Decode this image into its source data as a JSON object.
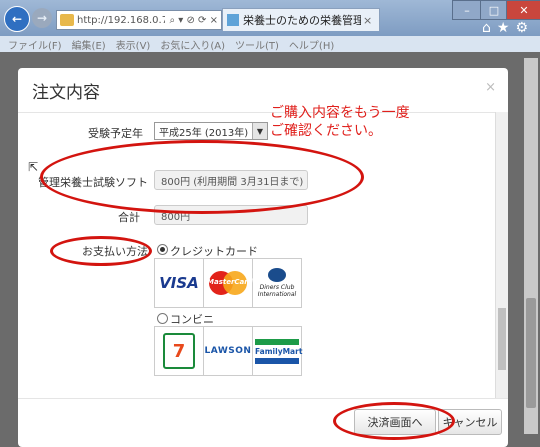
{
  "browser": {
    "url": "http://192.168.0.7:90",
    "address_tools": "⌕ ▾ ⊘ ⟳ ×",
    "tab_title": "栄養士のための栄養管理...",
    "tab_close": "×",
    "window_controls": [
      "–",
      "□",
      "✕"
    ],
    "toolbar_icons": "⌂★⚙",
    "menu": [
      "ファイル(F)",
      "編集(E)",
      "表示(V)",
      "お気に入り(A)",
      "ツール(T)",
      "ヘルプ(H)"
    ]
  },
  "modal": {
    "title": "注文内容",
    "close_label": "×",
    "exam_year_label": "受験予定年",
    "exam_year_value": "平成25年 (2013年)",
    "exam_year_arrow": "▼",
    "product_label": "管理栄養士試験ソフト",
    "product_value": "800円 (利用期間 3月31日まで)",
    "total_label": "合計",
    "total_value": "800円",
    "payment_label": "お支払い方法",
    "payment_options": [
      {
        "label": "クレジットカード",
        "selected": true
      },
      {
        "label": "コンビニ",
        "selected": false
      }
    ],
    "card_brands": [
      "VISA",
      "MasterCard",
      "Diners Club International"
    ],
    "store_brands": [
      "7",
      "LAWSON",
      "FamilyMart"
    ],
    "store_brand_subtext": "ELEVEN",
    "buttons": {
      "checkout": "決済画面へ",
      "cancel": "キャンセル"
    }
  },
  "annotation": {
    "note_line1": "ご購入内容をもう一度",
    "note_line2": "ご確認ください。",
    "color": "#d3140f"
  },
  "colors": {
    "accent": "#2f6fc1",
    "annotation_red": "#d3140f",
    "close_red": "#c9463d"
  }
}
